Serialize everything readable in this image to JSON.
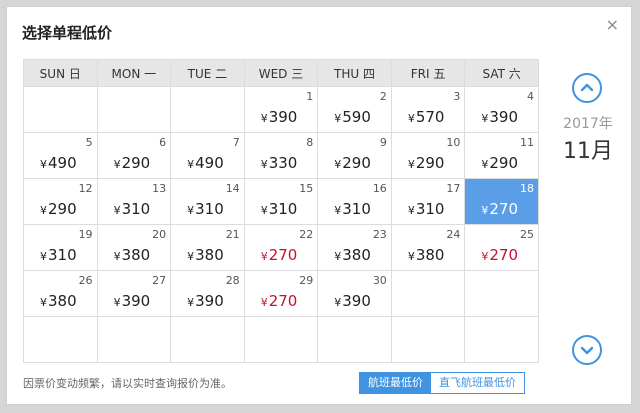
{
  "dialog": {
    "title": "选择单程低价",
    "close_label": "×"
  },
  "weekdays": [
    "SUN 日",
    "MON 一",
    "TUE 二",
    "WED 三",
    "THU 四",
    "FRI 五",
    "SAT 六"
  ],
  "currency": "¥",
  "calendar": {
    "year_label": "2017年",
    "month_label": "11月",
    "weeks": [
      [
        null,
        null,
        null,
        {
          "day": "1",
          "price": "390"
        },
        {
          "day": "2",
          "price": "590"
        },
        {
          "day": "3",
          "price": "570"
        },
        {
          "day": "4",
          "price": "390"
        }
      ],
      [
        {
          "day": "5",
          "price": "490"
        },
        {
          "day": "6",
          "price": "290"
        },
        {
          "day": "7",
          "price": "490"
        },
        {
          "day": "8",
          "price": "330"
        },
        {
          "day": "9",
          "price": "290"
        },
        {
          "day": "10",
          "price": "290"
        },
        {
          "day": "11",
          "price": "290"
        }
      ],
      [
        {
          "day": "12",
          "price": "290"
        },
        {
          "day": "13",
          "price": "310"
        },
        {
          "day": "14",
          "price": "310"
        },
        {
          "day": "15",
          "price": "310"
        },
        {
          "day": "16",
          "price": "310"
        },
        {
          "day": "17",
          "price": "310"
        },
        {
          "day": "18",
          "price": "270",
          "selected": true
        }
      ],
      [
        {
          "day": "19",
          "price": "310"
        },
        {
          "day": "20",
          "price": "380"
        },
        {
          "day": "21",
          "price": "380"
        },
        {
          "day": "22",
          "price": "270",
          "lowest": true
        },
        {
          "day": "23",
          "price": "380"
        },
        {
          "day": "24",
          "price": "380"
        },
        {
          "day": "25",
          "price": "270",
          "lowest": true
        }
      ],
      [
        {
          "day": "26",
          "price": "380"
        },
        {
          "day": "27",
          "price": "390"
        },
        {
          "day": "28",
          "price": "390"
        },
        {
          "day": "29",
          "price": "270",
          "lowest": true
        },
        {
          "day": "30",
          "price": "390"
        },
        null,
        null
      ],
      [
        null,
        null,
        null,
        null,
        null,
        null,
        null
      ]
    ]
  },
  "colors": {
    "accent": "#3f93e0",
    "selected": "#5b9ee8",
    "lowest_price": "#c8102e"
  },
  "icons": {
    "prev": "chevron-up-circle-icon",
    "next": "chevron-down-circle-icon"
  },
  "footer": {
    "note": "因票价变动频繁，请以实时查询报价为准。",
    "tabs": [
      {
        "label": "航班最低价",
        "active": true
      },
      {
        "label": "直飞航班最低价",
        "active": false
      }
    ]
  }
}
